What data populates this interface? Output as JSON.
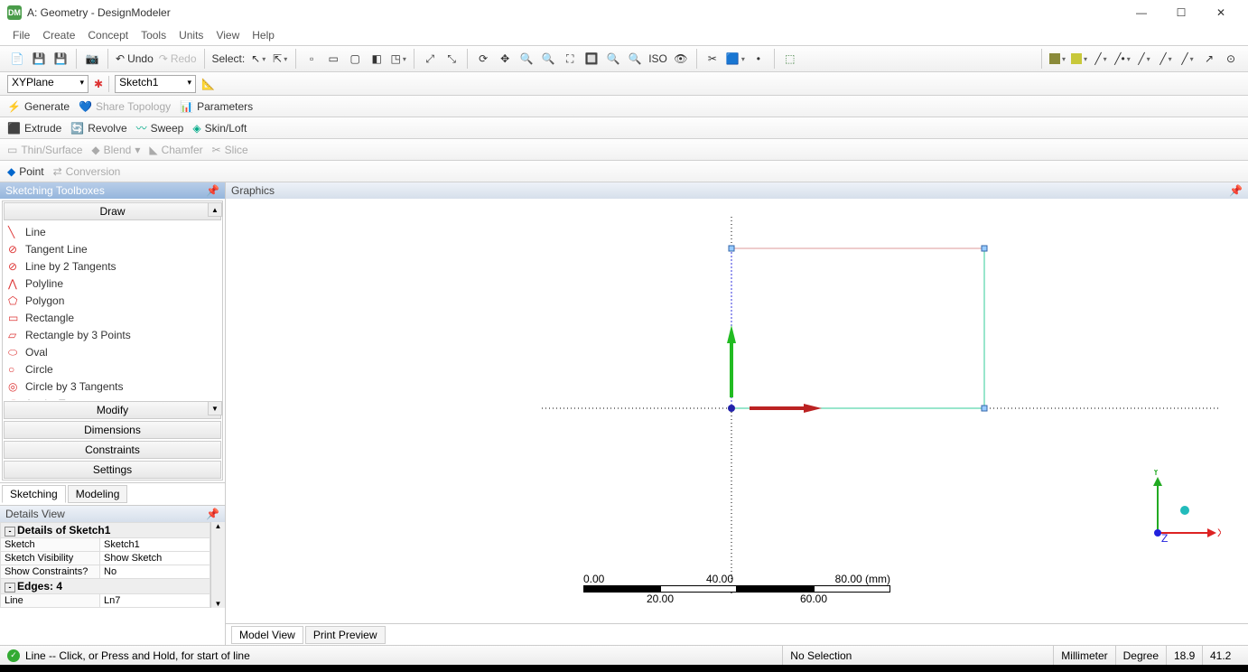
{
  "window": {
    "title": "A: Geometry - DesignModeler"
  },
  "menu": [
    "File",
    "Create",
    "Concept",
    "Tools",
    "Units",
    "View",
    "Help"
  ],
  "toolbar1": {
    "undo": "Undo",
    "redo": "Redo",
    "select": "Select:"
  },
  "row2": {
    "plane": "XYPlane",
    "sketch": "Sketch1"
  },
  "row3": {
    "generate": "Generate",
    "share": "Share Topology",
    "parameters": "Parameters"
  },
  "row4": {
    "extrude": "Extrude",
    "revolve": "Revolve",
    "sweep": "Sweep",
    "skinloft": "Skin/Loft"
  },
  "row5": {
    "thin": "Thin/Surface",
    "blend": "Blend",
    "chamfer": "Chamfer",
    "slice": "Slice"
  },
  "row6": {
    "point": "Point",
    "conversion": "Conversion"
  },
  "toolbox": {
    "title": "Sketching Toolboxes",
    "draw": "Draw",
    "items": [
      "Line",
      "Tangent Line",
      "Line by 2 Tangents",
      "Polyline",
      "Polygon",
      "Rectangle",
      "Rectangle by 3 Points",
      "Oval",
      "Circle",
      "Circle by 3 Tangents",
      "Arc by Tangent"
    ],
    "sections": [
      "Modify",
      "Dimensions",
      "Constraints",
      "Settings"
    ],
    "tabs": {
      "sketching": "Sketching",
      "modeling": "Modeling"
    }
  },
  "details": {
    "title": "Details View",
    "group1": "Details of Sketch1",
    "rows1": [
      {
        "k": "Sketch",
        "v": "Sketch1"
      },
      {
        "k": "Sketch Visibility",
        "v": "Show Sketch"
      },
      {
        "k": "Show Constraints?",
        "v": "No"
      }
    ],
    "group2": "Edges: 4",
    "rows2": [
      {
        "k": "Line",
        "v": "Ln7"
      }
    ]
  },
  "graphics": {
    "title": "Graphics",
    "scale": {
      "labels": [
        "0.00",
        "20.00",
        "40.00",
        "60.00",
        "80.00"
      ],
      "unit": "(mm)"
    },
    "triad": {
      "x": "X",
      "y": "Y",
      "z": "Z"
    },
    "tabs": {
      "model": "Model View",
      "print": "Print Preview"
    }
  },
  "status": {
    "hint": "Line -- Click, or Press and Hold, for start of line",
    "selection": "No Selection",
    "unit1": "Millimeter",
    "unit2": "Degree",
    "coord1": "18.9",
    "coord2": "41.2"
  }
}
